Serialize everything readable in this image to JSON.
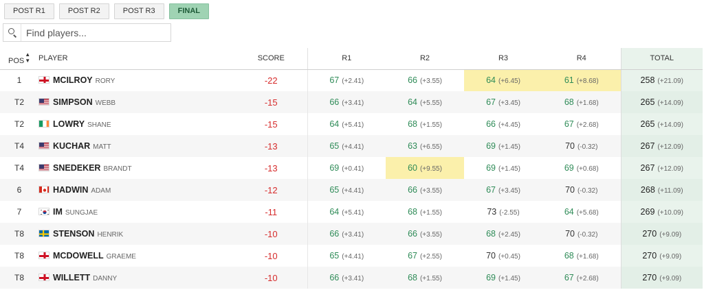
{
  "tabs": [
    {
      "label": "POST R1",
      "active": false
    },
    {
      "label": "POST R2",
      "active": false
    },
    {
      "label": "POST R3",
      "active": false
    },
    {
      "label": "FINAL",
      "active": true
    }
  ],
  "search": {
    "placeholder": "Find players..."
  },
  "headers": {
    "pos": "POS",
    "player": "PLAYER",
    "score": "SCORE",
    "r1": "R1",
    "r2": "R2",
    "r3": "R3",
    "r4": "R4",
    "total": "TOTAL"
  },
  "colors": {
    "under_par": "#d62b2b",
    "round_under": "#2e8b57",
    "highlight": "#fbf0ab",
    "total_bg": "#e9f3ec",
    "active_tab": "#9fd3b3"
  },
  "rows": [
    {
      "pos": "1",
      "flag": "england",
      "last": "MCILROY",
      "first": "RORY",
      "score": "-22",
      "rounds": [
        {
          "s": "67",
          "rel": "(+2.41)",
          "hl": false,
          "u": true
        },
        {
          "s": "66",
          "rel": "(+3.55)",
          "hl": false,
          "u": true
        },
        {
          "s": "64",
          "rel": "(+6.45)",
          "hl": true,
          "u": true
        },
        {
          "s": "61",
          "rel": "(+8.68)",
          "hl": true,
          "u": true
        }
      ],
      "total": "258",
      "total_rel": "(+21.09)"
    },
    {
      "pos": "T2",
      "flag": "usa",
      "last": "SIMPSON",
      "first": "WEBB",
      "score": "-15",
      "rounds": [
        {
          "s": "66",
          "rel": "(+3.41)",
          "hl": false,
          "u": true
        },
        {
          "s": "64",
          "rel": "(+5.55)",
          "hl": false,
          "u": true
        },
        {
          "s": "67",
          "rel": "(+3.45)",
          "hl": false,
          "u": true
        },
        {
          "s": "68",
          "rel": "(+1.68)",
          "hl": false,
          "u": true
        }
      ],
      "total": "265",
      "total_rel": "(+14.09)"
    },
    {
      "pos": "T2",
      "flag": "ireland",
      "last": "LOWRY",
      "first": "SHANE",
      "score": "-15",
      "rounds": [
        {
          "s": "64",
          "rel": "(+5.41)",
          "hl": false,
          "u": true
        },
        {
          "s": "68",
          "rel": "(+1.55)",
          "hl": false,
          "u": true
        },
        {
          "s": "66",
          "rel": "(+4.45)",
          "hl": false,
          "u": true
        },
        {
          "s": "67",
          "rel": "(+2.68)",
          "hl": false,
          "u": true
        }
      ],
      "total": "265",
      "total_rel": "(+14.09)"
    },
    {
      "pos": "T4",
      "flag": "usa",
      "last": "KUCHAR",
      "first": "MATT",
      "score": "-13",
      "rounds": [
        {
          "s": "65",
          "rel": "(+4.41)",
          "hl": false,
          "u": true
        },
        {
          "s": "63",
          "rel": "(+6.55)",
          "hl": false,
          "u": true
        },
        {
          "s": "69",
          "rel": "(+1.45)",
          "hl": false,
          "u": true
        },
        {
          "s": "70",
          "rel": "(-0.32)",
          "hl": false,
          "u": false
        }
      ],
      "total": "267",
      "total_rel": "(+12.09)"
    },
    {
      "pos": "T4",
      "flag": "usa",
      "last": "SNEDEKER",
      "first": "BRANDT",
      "score": "-13",
      "rounds": [
        {
          "s": "69",
          "rel": "(+0.41)",
          "hl": false,
          "u": true
        },
        {
          "s": "60",
          "rel": "(+9.55)",
          "hl": true,
          "u": true
        },
        {
          "s": "69",
          "rel": "(+1.45)",
          "hl": false,
          "u": true
        },
        {
          "s": "69",
          "rel": "(+0.68)",
          "hl": false,
          "u": true
        }
      ],
      "total": "267",
      "total_rel": "(+12.09)"
    },
    {
      "pos": "6",
      "flag": "canada",
      "last": "HADWIN",
      "first": "ADAM",
      "score": "-12",
      "rounds": [
        {
          "s": "65",
          "rel": "(+4.41)",
          "hl": false,
          "u": true
        },
        {
          "s": "66",
          "rel": "(+3.55)",
          "hl": false,
          "u": true
        },
        {
          "s": "67",
          "rel": "(+3.45)",
          "hl": false,
          "u": true
        },
        {
          "s": "70",
          "rel": "(-0.32)",
          "hl": false,
          "u": false
        }
      ],
      "total": "268",
      "total_rel": "(+11.09)"
    },
    {
      "pos": "7",
      "flag": "korea",
      "last": "IM",
      "first": "SUNGJAE",
      "score": "-11",
      "rounds": [
        {
          "s": "64",
          "rel": "(+5.41)",
          "hl": false,
          "u": true
        },
        {
          "s": "68",
          "rel": "(+1.55)",
          "hl": false,
          "u": true
        },
        {
          "s": "73",
          "rel": "(-2.55)",
          "hl": false,
          "u": false
        },
        {
          "s": "64",
          "rel": "(+5.68)",
          "hl": false,
          "u": true
        }
      ],
      "total": "269",
      "total_rel": "(+10.09)"
    },
    {
      "pos": "T8",
      "flag": "sweden",
      "last": "STENSON",
      "first": "HENRIK",
      "score": "-10",
      "rounds": [
        {
          "s": "66",
          "rel": "(+3.41)",
          "hl": false,
          "u": true
        },
        {
          "s": "66",
          "rel": "(+3.55)",
          "hl": false,
          "u": true
        },
        {
          "s": "68",
          "rel": "(+2.45)",
          "hl": false,
          "u": true
        },
        {
          "s": "70",
          "rel": "(-0.32)",
          "hl": false,
          "u": false
        }
      ],
      "total": "270",
      "total_rel": "(+9.09)"
    },
    {
      "pos": "T8",
      "flag": "northern-ireland",
      "last": "MCDOWELL",
      "first": "GRAEME",
      "score": "-10",
      "rounds": [
        {
          "s": "65",
          "rel": "(+4.41)",
          "hl": false,
          "u": true
        },
        {
          "s": "67",
          "rel": "(+2.55)",
          "hl": false,
          "u": true
        },
        {
          "s": "70",
          "rel": "(+0.45)",
          "hl": false,
          "u": false
        },
        {
          "s": "68",
          "rel": "(+1.68)",
          "hl": false,
          "u": true
        }
      ],
      "total": "270",
      "total_rel": "(+9.09)"
    },
    {
      "pos": "T8",
      "flag": "england",
      "last": "WILLETT",
      "first": "DANNY",
      "score": "-10",
      "rounds": [
        {
          "s": "66",
          "rel": "(+3.41)",
          "hl": false,
          "u": true
        },
        {
          "s": "68",
          "rel": "(+1.55)",
          "hl": false,
          "u": true
        },
        {
          "s": "69",
          "rel": "(+1.45)",
          "hl": false,
          "u": true
        },
        {
          "s": "67",
          "rel": "(+2.68)",
          "hl": false,
          "u": true
        }
      ],
      "total": "270",
      "total_rel": "(+9.09)"
    }
  ]
}
